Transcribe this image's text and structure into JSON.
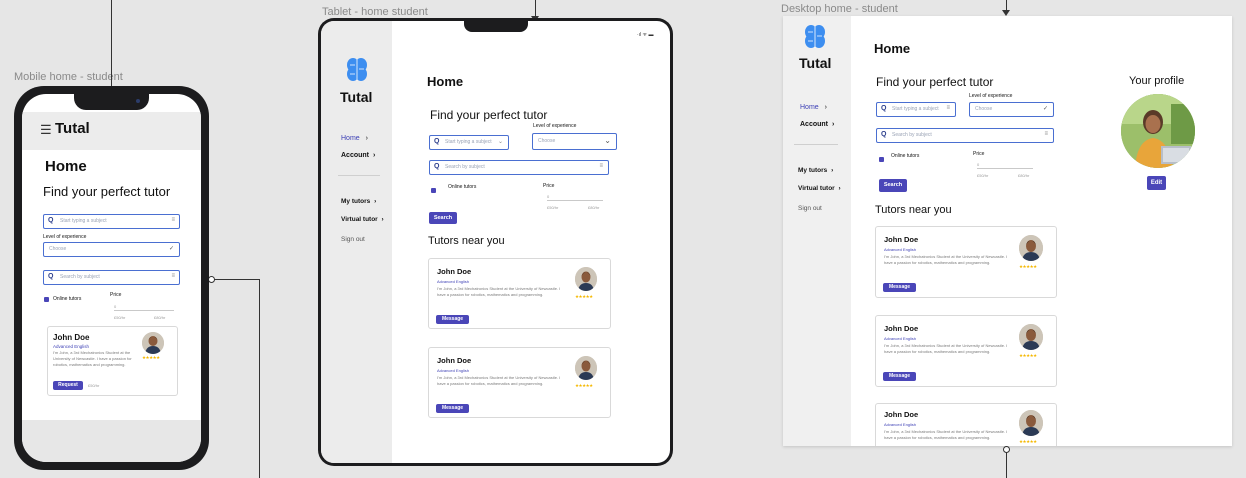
{
  "frames": {
    "mobile_label": "Mobile home - student",
    "tablet_label": "Tablet - home student",
    "desktop_label": "Desktop home - student"
  },
  "brand": {
    "name": "Tutal",
    "accent": "#4a46b8",
    "link": "#3c3fb5",
    "star": "#f5b800"
  },
  "nav": {
    "home": "Home",
    "account": "Account",
    "my_tutors": "My tutors",
    "virtual_tutor": "Virtual tutor",
    "sign_out": "Sign out",
    "chevron": "›"
  },
  "page": {
    "title": "Home",
    "subtitle": "Find your perfect tutor",
    "tutors_heading": "Tutors near you",
    "profile_heading": "Your profile",
    "edit_label": "Edit"
  },
  "form": {
    "subject_placeholder": "Start typing a subject",
    "level_label": "Level of experience",
    "level_placeholder": "Choose",
    "search_subject_placeholder": "Search by subject",
    "online_label": "Online tutors",
    "price_label": "Price",
    "price_min": "0",
    "price_low": "£50/hr",
    "price_high": "£80/hr",
    "search_button": "Search"
  },
  "tutor": {
    "name": "John Doe",
    "subject": "Advanced English",
    "bio": "I'm John, a 3rd Mechatronics Student at the University of Newcastle. I have a passion for robotics, mathematics and programming.",
    "stars": "★★★★★",
    "message_button": "Message",
    "request_button": "Request",
    "rate": "£50/hr"
  },
  "tablet_status": "·ıl ᯤ ▬",
  "icons": {
    "menu": "hamburger-icon",
    "search": "search-icon",
    "filter": "filter-icon",
    "brain": "brain-logo-icon"
  }
}
